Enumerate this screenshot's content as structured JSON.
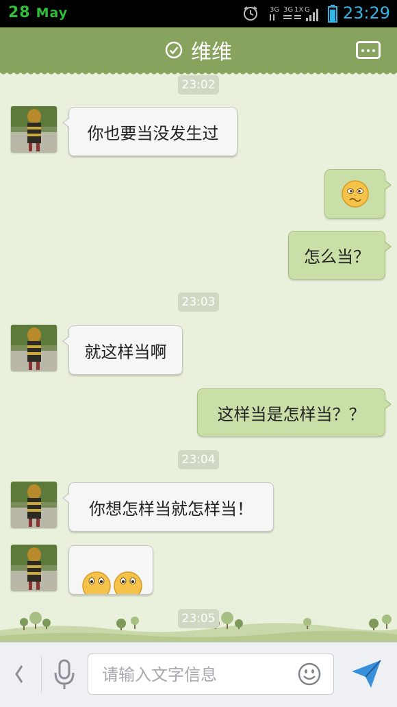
{
  "status_bar": {
    "day": "28",
    "month": "May",
    "time": "23:29",
    "network_labels": [
      "3G",
      "3G",
      "1X",
      "G"
    ]
  },
  "header": {
    "title": "维维",
    "verified_icon": "check-circle-icon",
    "menu_icon": "more-icon"
  },
  "timestamps": [
    "23:02",
    "23:03",
    "23:04",
    "23:05"
  ],
  "messages": [
    {
      "direction": "in",
      "text": "你也要当没发生过"
    },
    {
      "direction": "out",
      "emoji": "confused-face"
    },
    {
      "direction": "out",
      "text": "怎么当？"
    },
    {
      "direction": "in",
      "text": "就这样当啊"
    },
    {
      "direction": "out",
      "text": "这样当是怎样当？？"
    },
    {
      "direction": "in",
      "text": "你想怎样当就怎样当！"
    },
    {
      "direction": "in",
      "emoji": "peeking-faces"
    }
  ],
  "input_bar": {
    "back_icon": "chevron-left-icon",
    "voice_icon": "microphone-icon",
    "placeholder": "请输入文字信息",
    "emoji_icon": "smiley-icon",
    "send_icon": "send-icon"
  },
  "colors": {
    "header": "#87a35d",
    "background": "#e9f1dc",
    "outgoing_bubble": "#cadfa7",
    "incoming_bubble": "#f6f6f6",
    "time": "#33b5e5",
    "date": "#2fbf3a"
  }
}
